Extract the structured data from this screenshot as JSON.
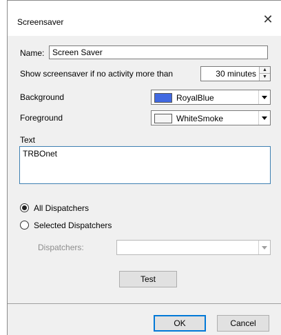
{
  "window": {
    "title": "Screensaver",
    "close_glyph": "✕"
  },
  "form": {
    "name_label": "Name:",
    "name_value": "Screen Saver",
    "activity_label": "Show screensaver if no activity more than",
    "activity_value": "30 minutes",
    "background_label": "Background",
    "background_value": "RoyalBlue",
    "background_color": "#4169E1",
    "foreground_label": "Foreground",
    "foreground_value": "WhiteSmoke",
    "foreground_color": "#F5F5F5",
    "text_label": "Text",
    "text_value": "TRBOnet"
  },
  "dispatchers": {
    "option_all": "All Dispatchers",
    "option_selected": "Selected Dispatchers",
    "selected_option": "All Dispatchers",
    "dispatchers_label": "Dispatchers:",
    "dispatchers_value": ""
  },
  "buttons": {
    "test": "Test",
    "ok": "OK",
    "cancel": "Cancel"
  },
  "icons": {
    "spin_up": "▲",
    "spin_down": "▼",
    "close": "close-icon",
    "dropdown": "chevron-down-icon"
  }
}
